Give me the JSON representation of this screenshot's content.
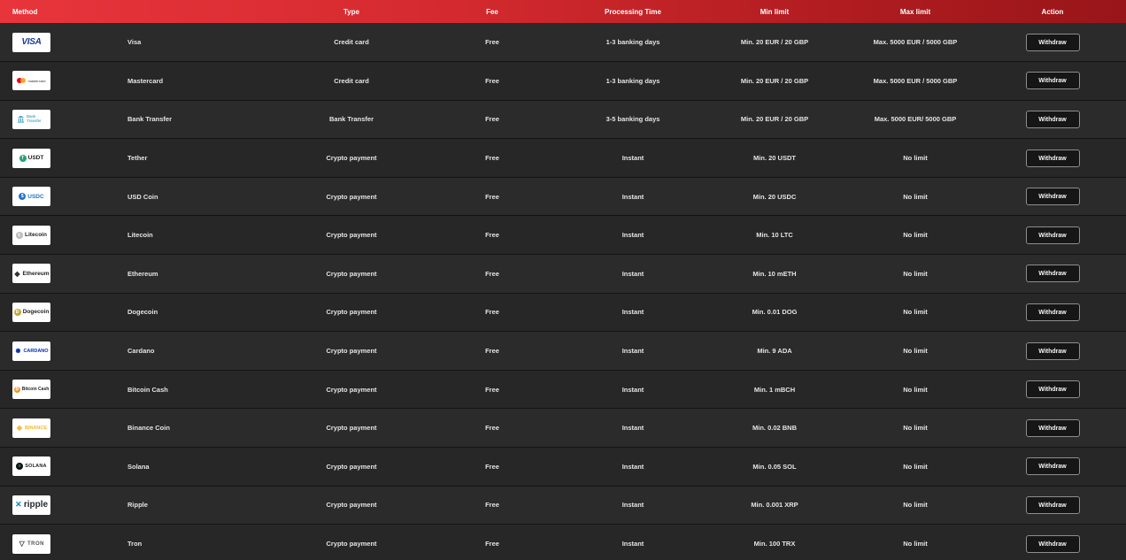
{
  "headers": {
    "method": "Method",
    "type": "Type",
    "fee": "Fee",
    "processing_time": "Processing Time",
    "min_limit": "Min limit",
    "max_limit": "Max limit",
    "action": "Action"
  },
  "rows": [
    {
      "logo_text": "VISA",
      "logo_icon": "visa-logo",
      "name": "Visa",
      "type": "Credit card",
      "fee": "Free",
      "processing_time": "1-3 banking days",
      "min_limit": "Min. 20 EUR / 20 GBP",
      "max_limit": "Max. 5000 EUR / 5000 GBP",
      "action": "Withdraw"
    },
    {
      "logo_text": "mastercard",
      "logo_icon": "mastercard-logo",
      "name": "Mastercard",
      "type": "Credit card",
      "fee": "Free",
      "processing_time": "1-3 banking days",
      "min_limit": "Min. 20 EUR / 20 GBP",
      "max_limit": "Max. 5000 EUR / 5000 GBP",
      "action": "Withdraw"
    },
    {
      "logo_text": "Bank Transfer",
      "logo_icon": "bank-icon",
      "name": "Bank Transfer",
      "type": "Bank Transfer",
      "fee": "Free",
      "processing_time": "3-5 banking days",
      "min_limit": "Min. 20 EUR / 20 GBP",
      "max_limit": "Max. 5000 EUR/ 5000 GBP",
      "action": "Withdraw"
    },
    {
      "logo_text": "USDT",
      "logo_icon": "tether-icon",
      "name": "Tether",
      "type": "Crypto payment",
      "fee": "Free",
      "processing_time": "Instant",
      "min_limit": "Min. 20 USDT",
      "max_limit": "No limit",
      "action": "Withdraw"
    },
    {
      "logo_text": "USDC",
      "logo_icon": "usdc-icon",
      "name": "USD Coin",
      "type": "Crypto payment",
      "fee": "Free",
      "processing_time": "Instant",
      "min_limit": "Min. 20 USDC",
      "max_limit": "No limit",
      "action": "Withdraw"
    },
    {
      "logo_text": "Litecoin",
      "logo_icon": "litecoin-icon",
      "name": "Litecoin",
      "type": "Crypto payment",
      "fee": "Free",
      "processing_time": "Instant",
      "min_limit": "Min. 10 LTC",
      "max_limit": "No limit",
      "action": "Withdraw"
    },
    {
      "logo_text": "Ethereum",
      "logo_icon": "ethereum-icon",
      "name": "Ethereum",
      "type": "Crypto payment",
      "fee": "Free",
      "processing_time": "Instant",
      "min_limit": "Min. 10 mETH",
      "max_limit": "No limit",
      "action": "Withdraw"
    },
    {
      "logo_text": "Dogecoin",
      "logo_icon": "dogecoin-icon",
      "name": "Dogecoin",
      "type": "Crypto payment",
      "fee": "Free",
      "processing_time": "Instant",
      "min_limit": "Min. 0.01 DOG",
      "max_limit": "No limit",
      "action": "Withdraw"
    },
    {
      "logo_text": "CARDANO",
      "logo_icon": "cardano-icon",
      "name": "Cardano",
      "type": "Crypto payment",
      "fee": "Free",
      "processing_time": "Instant",
      "min_limit": "Min. 9 ADA",
      "max_limit": "No limit",
      "action": "Withdraw"
    },
    {
      "logo_text": "Bitcoin Cash",
      "logo_icon": "bitcoin-cash-icon",
      "name": "Bitcoin Cash",
      "type": "Crypto payment",
      "fee": "Free",
      "processing_time": "Instant",
      "min_limit": "Min. 1 mBCH",
      "max_limit": "No limit",
      "action": "Withdraw"
    },
    {
      "logo_text": "BINANCE",
      "logo_icon": "binance-icon",
      "name": "Binance Coin",
      "type": "Crypto payment",
      "fee": "Free",
      "processing_time": "Instant",
      "min_limit": "Min. 0.02 BNB",
      "max_limit": "No limit",
      "action": "Withdraw"
    },
    {
      "logo_text": "SOLANA",
      "logo_icon": "solana-icon",
      "name": "Solana",
      "type": "Crypto payment",
      "fee": "Free",
      "processing_time": "Instant",
      "min_limit": "Min. 0.05 SOL",
      "max_limit": "No limit",
      "action": "Withdraw"
    },
    {
      "logo_text": "ripple",
      "logo_icon": "ripple-icon",
      "name": "Ripple",
      "type": "Crypto payment",
      "fee": "Free",
      "processing_time": "Instant",
      "min_limit": "Min. 0.001 XRP",
      "max_limit": "No limit",
      "action": "Withdraw"
    },
    {
      "logo_text": "TRON",
      "logo_icon": "tron-icon",
      "name": "Tron",
      "type": "Crypto payment",
      "fee": "Free",
      "processing_time": "Instant",
      "min_limit": "Min. 100 TRX",
      "max_limit": "No limit",
      "action": "Withdraw"
    }
  ],
  "colors": {
    "header_start": "#e8353c",
    "header_end": "#981519",
    "row_bg": "#2b2b2b",
    "button_bg": "#161616"
  }
}
